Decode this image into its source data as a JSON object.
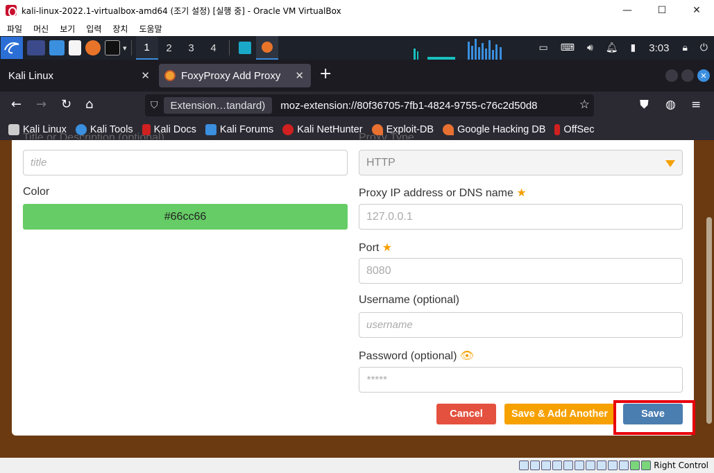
{
  "host": {
    "title": "kali-linux-2022.1-virtualbox-amd64 (조기 설정) [실행 중] - Oracle VM VirtualBox",
    "controls": [
      "—",
      "☐",
      "✕"
    ],
    "menu": [
      "파일",
      "머신",
      "보기",
      "입력",
      "장치",
      "도움말"
    ],
    "status_text": "Right Control"
  },
  "panel": {
    "workspaces": [
      "1",
      "2",
      "3",
      "4"
    ],
    "clock": "3:03"
  },
  "browser": {
    "tabs": [
      {
        "label": "Kali Linux",
        "close": "✕"
      },
      {
        "label": "FoxyProxy Add Proxy",
        "close": "✕"
      }
    ],
    "new_tab": "+",
    "url_identity": "Extension…tandard)",
    "url": "moz-extension://80f36705-7fb1-4824-9755-c76c2d50d8",
    "bookmarks": [
      {
        "label": "Kali Linux",
        "color": "#cccccc"
      },
      {
        "label": "Kali Tools",
        "color": "#3a8fdf"
      },
      {
        "label": "Kali Docs",
        "color": "#d02020"
      },
      {
        "label": "Kali Forums",
        "color": "#3a8fdf"
      },
      {
        "label": "Kali NetHunter",
        "color": "#d02020"
      },
      {
        "label": "Exploit-DB",
        "color": "#e87030"
      },
      {
        "label": "Google Hacking DB",
        "color": "#e87030"
      },
      {
        "label": "OffSec",
        "color": "#d02020"
      }
    ]
  },
  "form": {
    "cut_left_label": "Title or Description (optional)",
    "cut_right_label": "Proxy Type",
    "title_placeholder": "title",
    "proxy_type_value": "HTTP",
    "color_label": "Color",
    "color_value": "#66cc66",
    "ip_label": "Proxy IP address or DNS name",
    "ip_placeholder": "127.0.0.1",
    "port_label": "Port",
    "port_placeholder": "8080",
    "username_label": "Username (optional)",
    "username_placeholder": "username",
    "password_label": "Password (optional)",
    "password_placeholder": "*****",
    "cancel_label": "Cancel",
    "add_another_label": "Save & Add Another",
    "save_label": "Save"
  },
  "colors": {
    "page_bg": "#6b3a10",
    "cancel": "#e4513f",
    "add_another": "#f7a100",
    "save": "#4a7db0",
    "highlight": "#e8000b"
  }
}
